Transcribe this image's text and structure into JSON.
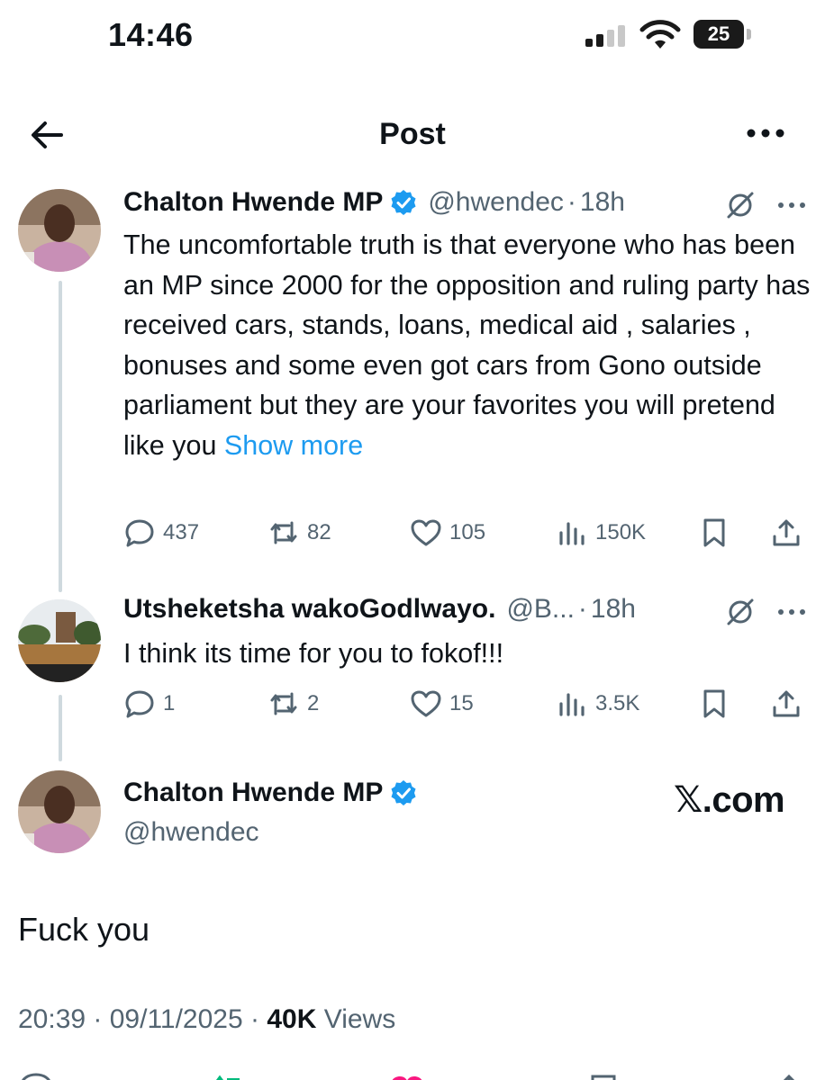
{
  "status_bar": {
    "time": "14:46",
    "battery": "25"
  },
  "header": {
    "title": "Post"
  },
  "tweets": [
    {
      "name": "Chalton Hwende MP",
      "verified": true,
      "handle": "@hwendec",
      "age": "18h",
      "text": "The uncomfortable truth is that everyone who has been an MP since 2000 for the opposition and ruling party has received cars, stands, loans, medical aid , salaries , bonuses and some even got cars from Gono outside parliament but they are your favorites you will pretend like you",
      "show_more": "Show more",
      "replies": "437",
      "reposts": "82",
      "likes": "105",
      "views": "150K"
    },
    {
      "name": "Utsheketsha wakoGodlwayo.",
      "verified": false,
      "handle": "@B...",
      "age": "18h",
      "text": "I think its time for you to fokof!!!",
      "replies": "1",
      "reposts": "2",
      "likes": "15",
      "views": "3.5K"
    }
  ],
  "main_post": {
    "name": "Chalton Hwende MP",
    "verified": true,
    "handle": "@hwendec",
    "brand": "𝕏.com",
    "text": "Fuck you",
    "time": "20:39",
    "date": "09/11/2025",
    "views_count": "40K",
    "views_label": "Views"
  },
  "colors": {
    "accent": "#1d9bf0",
    "secondary_text": "#536471",
    "thread_line": "#cfd9de"
  },
  "icons": [
    "back-arrow-icon",
    "more-icon",
    "verified-badge-icon",
    "grok-icon",
    "reply-icon",
    "repost-icon",
    "like-icon",
    "views-icon",
    "bookmark-icon",
    "share-icon"
  ]
}
